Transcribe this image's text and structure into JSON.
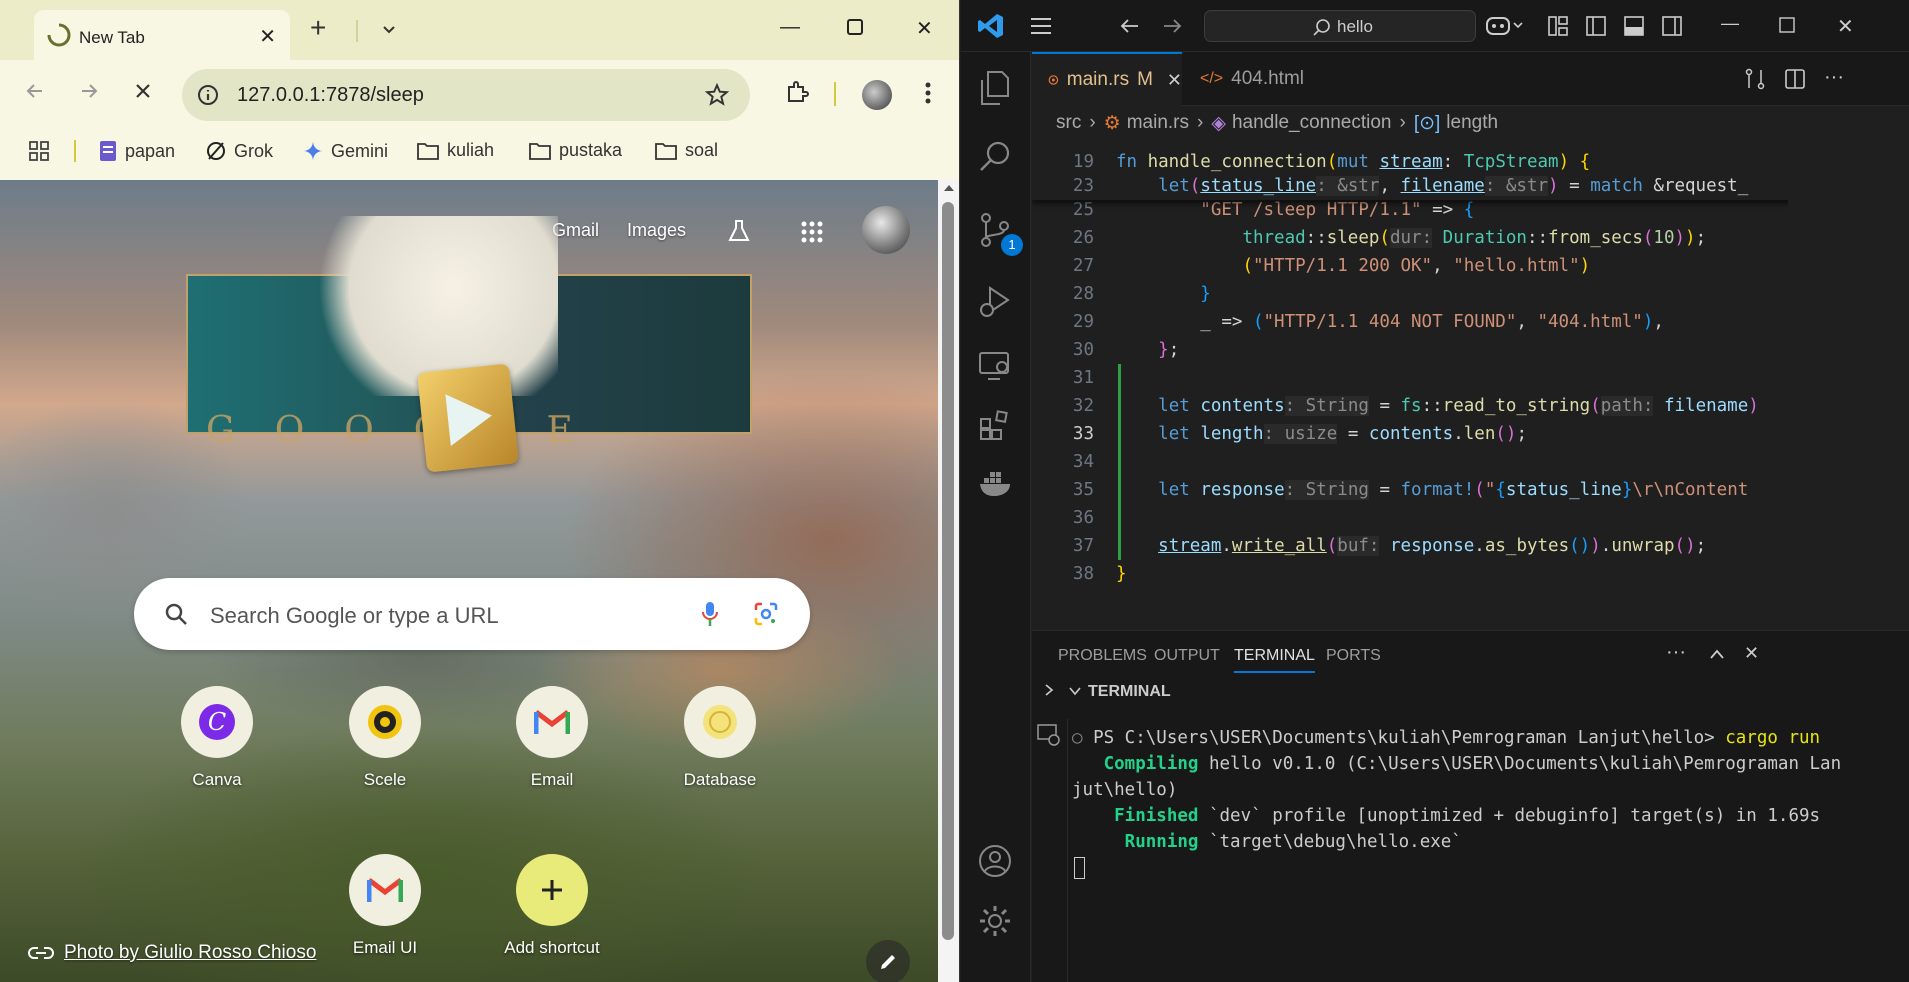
{
  "chrome": {
    "tab_title": "New Tab",
    "url": "127.0.0.1:7878/sleep",
    "bookmarks": [
      "papan",
      "Grok",
      "Gemini",
      "kuliah",
      "pustaka",
      "soal"
    ],
    "ntp": {
      "gmail": "Gmail",
      "images": "Images",
      "search_placeholder": "Search Google or type a URL",
      "doodle_word": "GOOGLE",
      "shortcuts": [
        "Canva",
        "Scele",
        "Email",
        "Database",
        "Email UI",
        "Add shortcut"
      ],
      "photo_credit": "Photo by Giulio Rosso Chioso"
    }
  },
  "vscode": {
    "search": "hello",
    "tabs": [
      {
        "name": "main.rs",
        "status": "M"
      },
      {
        "name": "404.html"
      }
    ],
    "breadcrumbs": [
      "src",
      "main.rs",
      "handle_connection",
      "length"
    ],
    "activity_badge": "1",
    "code_lines": [
      {
        "n": "19",
        "parts": [
          [
            "kw",
            "fn "
          ],
          [
            "fn",
            "handle_connection"
          ],
          [
            "br1",
            "("
          ],
          [
            "kw",
            "mut "
          ],
          [
            "var u",
            "stream"
          ],
          [
            "pl",
            ": "
          ],
          [
            "ty",
            "TcpStream"
          ],
          [
            "br1",
            ")"
          ],
          [
            "pl",
            " "
          ],
          [
            "br1",
            "{"
          ]
        ]
      },
      {
        "n": "23",
        "parts": [
          [
            "pl",
            "    "
          ],
          [
            "kw",
            "let"
          ],
          [
            "br2",
            "("
          ],
          [
            "var u",
            "status_line"
          ],
          [
            "hint",
            ": &str"
          ],
          [
            "pl",
            ", "
          ],
          [
            "var u",
            "filename"
          ],
          [
            "hint",
            ": &str"
          ],
          [
            "br2",
            ")"
          ],
          [
            "pl",
            " = "
          ],
          [
            "kw",
            "match "
          ],
          [
            "pl",
            "&request_"
          ]
        ]
      },
      {
        "n": "25",
        "parts": [
          [
            "pl",
            "        "
          ],
          [
            "str",
            "\"GET /sleep HTTP/1.1\""
          ],
          [
            "pl",
            " => "
          ],
          [
            "br3",
            "{"
          ]
        ]
      },
      {
        "n": "26",
        "parts": [
          [
            "pl",
            "            "
          ],
          [
            "ty",
            "thread"
          ],
          [
            "pl",
            "::"
          ],
          [
            "fn",
            "sleep"
          ],
          [
            "br1",
            "("
          ],
          [
            "hint",
            "dur:"
          ],
          [
            "pl",
            " "
          ],
          [
            "ty",
            "Duration"
          ],
          [
            "pl",
            "::"
          ],
          [
            "fn",
            "from_secs"
          ],
          [
            "br2",
            "("
          ],
          [
            "nm",
            "10"
          ],
          [
            "br2",
            ")"
          ],
          [
            "br1",
            ")"
          ],
          [
            "pl",
            ";"
          ]
        ]
      },
      {
        "n": "27",
        "parts": [
          [
            "pl",
            "            "
          ],
          [
            "br1",
            "("
          ],
          [
            "str",
            "\"HTTP/1.1 200 OK\""
          ],
          [
            "pl",
            ", "
          ],
          [
            "str",
            "\"hello.html\""
          ],
          [
            "br1",
            ")"
          ]
        ]
      },
      {
        "n": "28",
        "parts": [
          [
            "pl",
            "        "
          ],
          [
            "br3",
            "}"
          ]
        ]
      },
      {
        "n": "29",
        "parts": [
          [
            "pl",
            "        _ => "
          ],
          [
            "br3",
            "("
          ],
          [
            "str",
            "\"HTTP/1.1 404 NOT FOUND\""
          ],
          [
            "pl",
            ", "
          ],
          [
            "str",
            "\"404.html\""
          ],
          [
            "br3",
            ")"
          ],
          [
            "pl",
            ","
          ]
        ]
      },
      {
        "n": "30",
        "parts": [
          [
            "pl",
            "    "
          ],
          [
            "br2",
            "}"
          ],
          [
            "pl",
            ";"
          ]
        ]
      },
      {
        "n": "31",
        "parts": []
      },
      {
        "n": "32",
        "parts": [
          [
            "pl",
            "    "
          ],
          [
            "kw",
            "let "
          ],
          [
            "var",
            "contents"
          ],
          [
            "hint",
            ": String"
          ],
          [
            "pl",
            " = "
          ],
          [
            "ty",
            "fs"
          ],
          [
            "pl",
            "::"
          ],
          [
            "fn",
            "read_to_string"
          ],
          [
            "br2",
            "("
          ],
          [
            "hint",
            "path:"
          ],
          [
            "pl",
            " "
          ],
          [
            "var",
            "filename"
          ],
          [
            "br2",
            ")"
          ]
        ]
      },
      {
        "n": "33",
        "parts": [
          [
            "pl",
            "    "
          ],
          [
            "kw",
            "let "
          ],
          [
            "var",
            "length"
          ],
          [
            "hint",
            ": usize"
          ],
          [
            "pl",
            " = "
          ],
          [
            "var",
            "contents"
          ],
          [
            "pl",
            "."
          ],
          [
            "fn",
            "len"
          ],
          [
            "br2",
            "()"
          ],
          [
            "pl",
            ";"
          ]
        ]
      },
      {
        "n": "34",
        "parts": []
      },
      {
        "n": "35",
        "parts": [
          [
            "pl",
            "    "
          ],
          [
            "kw",
            "let "
          ],
          [
            "var",
            "response"
          ],
          [
            "hint",
            ": String"
          ],
          [
            "pl",
            " = "
          ],
          [
            "mac",
            "format!"
          ],
          [
            "br2",
            "("
          ],
          [
            "str",
            "\""
          ],
          [
            "br3",
            "{"
          ],
          [
            "var",
            "status_line"
          ],
          [
            "br3",
            "}"
          ],
          [
            "str",
            "\\r\\nContent"
          ]
        ]
      },
      {
        "n": "36",
        "parts": []
      },
      {
        "n": "37",
        "parts": [
          [
            "pl",
            "    "
          ],
          [
            "var u",
            "stream"
          ],
          [
            "pl",
            "."
          ],
          [
            "fn u",
            "write_all"
          ],
          [
            "br2",
            "("
          ],
          [
            "hint",
            "buf:"
          ],
          [
            "pl",
            " "
          ],
          [
            "var",
            "response"
          ],
          [
            "pl",
            "."
          ],
          [
            "fn",
            "as_bytes"
          ],
          [
            "br3",
            "()"
          ],
          [
            "br2",
            ")"
          ],
          [
            "pl",
            "."
          ],
          [
            "fn",
            "unwrap"
          ],
          [
            "br2",
            "()"
          ],
          [
            "pl",
            ";"
          ]
        ]
      },
      {
        "n": "38",
        "parts": [
          [
            "br1",
            "}"
          ]
        ]
      }
    ],
    "panel_tabs": [
      "PROBLEMS",
      "OUTPUT",
      "TERMINAL",
      "PORTS"
    ],
    "terminal_header": "TERMINAL",
    "terminal": {
      "prompt": "PS C:\\Users\\USER\\Documents\\kuliah\\Pemrograman Lanjut\\hello> ",
      "cmd": "cargo run",
      "compiling_label": "   Compiling",
      "compiling_text": " hello v0.1.0 (C:\\Users\\USER\\Documents\\kuliah\\Pemrograman Lan",
      "compiling_wrap": "jut\\hello)",
      "finished_label": "    Finished",
      "finished_text": " `dev` profile [unoptimized + debuginfo] target(s) in 1.69s",
      "running_label": "     Running",
      "running_text": " `target\\debug\\hello.exe`"
    }
  }
}
